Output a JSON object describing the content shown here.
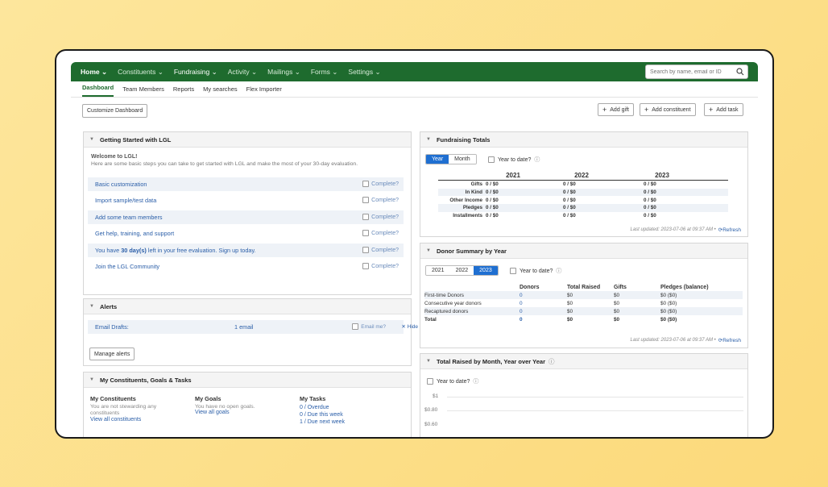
{
  "nav": {
    "items": [
      "Home",
      "Constituents",
      "Fundraising",
      "Activity",
      "Mailings",
      "Forms",
      "Settings"
    ],
    "search_placeholder": "Search by name, email or ID"
  },
  "subnav": [
    "Dashboard",
    "Team Members",
    "Reports",
    "My searches",
    "Flex Importer"
  ],
  "toolbar": {
    "customize": "Customize Dashboard",
    "add_gift": "Add gift",
    "add_constituent": "Add constituent",
    "add_task": "Add task"
  },
  "getting_started": {
    "title": "Getting Started with LGL",
    "welcome": "Welcome to LGL!",
    "intro": "Here are some basic steps you can take to get started with LGL and make the most of your 30-day evaluation.",
    "complete_label": "Complete?",
    "items": [
      "Basic customization",
      "Import sample/test data",
      "Add some team members",
      "Get help, training, and support",
      "Join the LGL Community"
    ],
    "eval_prefix": "You have ",
    "eval_days": "30 day(s)",
    "eval_suffix": " left in your free evaluation. Sign up today."
  },
  "alerts": {
    "title": "Alerts",
    "label": "Email Drafts:",
    "count": "1 email",
    "email_me": "Email me?",
    "hide": "Hide",
    "manage": "Manage alerts"
  },
  "goals": {
    "title": "My Constituents, Goals & Tasks",
    "constituents_title": "My Constituents",
    "constituents_text": "You are not stewarding any constituents",
    "constituents_link": "View all constituents",
    "goals_title": "My Goals",
    "goals_text": "You have no open goals.",
    "goals_link": "View all goals",
    "tasks_title": "My Tasks",
    "tasks": [
      "0 / Overdue",
      "0 / Due this week",
      "1 / Due next week"
    ]
  },
  "fundraising": {
    "title": "Fundraising Totals",
    "toggle": [
      "Year",
      "Month"
    ],
    "ytd": "Year to date?",
    "years": [
      "2021",
      "2022",
      "2023"
    ],
    "rows": [
      {
        "label": "Gifts",
        "values": [
          "0 / $0",
          "0 / $0",
          "0 / $0"
        ]
      },
      {
        "label": "In Kind",
        "values": [
          "0 / $0",
          "0 / $0",
          "0 / $0"
        ]
      },
      {
        "label": "Other Income",
        "values": [
          "0 / $0",
          "0 / $0",
          "0 / $0"
        ]
      },
      {
        "label": "Pledges",
        "values": [
          "0 / $0",
          "0 / $0",
          "0 / $0"
        ]
      },
      {
        "label": "Installments",
        "values": [
          "0 / $0",
          "0 / $0",
          "0 / $0"
        ]
      }
    ],
    "updated": "Last updated: 2023-07-06 at 09:37 AM •",
    "refresh": "Refresh"
  },
  "donor_summary": {
    "title": "Donor Summary by Year",
    "years": [
      "2021",
      "2022",
      "2023"
    ],
    "ytd": "Year to date?",
    "headers": [
      "Donors",
      "Total Raised",
      "Gifts",
      "Pledges (balance)"
    ],
    "rows": [
      {
        "label": "First-time Donors",
        "values": [
          "0",
          "$0",
          "$0",
          "$0 ($0)"
        ]
      },
      {
        "label": "Consecutive year donors",
        "values": [
          "0",
          "$0",
          "$0",
          "$0 ($0)"
        ]
      },
      {
        "label": "Recaptured donors",
        "values": [
          "0",
          "$0",
          "$0",
          "$0 ($0)"
        ]
      },
      {
        "label": "Total",
        "values": [
          "0",
          "$0",
          "$0",
          "$0 ($0)"
        ]
      }
    ],
    "updated": "Last updated: 2023-07-06 at 09:37 AM •",
    "refresh": "Refresh"
  },
  "raised_by_month": {
    "title": "Total Raised by Month, Year over Year",
    "ytd": "Year to date?",
    "y_ticks": [
      "$1",
      "$0.80",
      "$0.60"
    ]
  }
}
